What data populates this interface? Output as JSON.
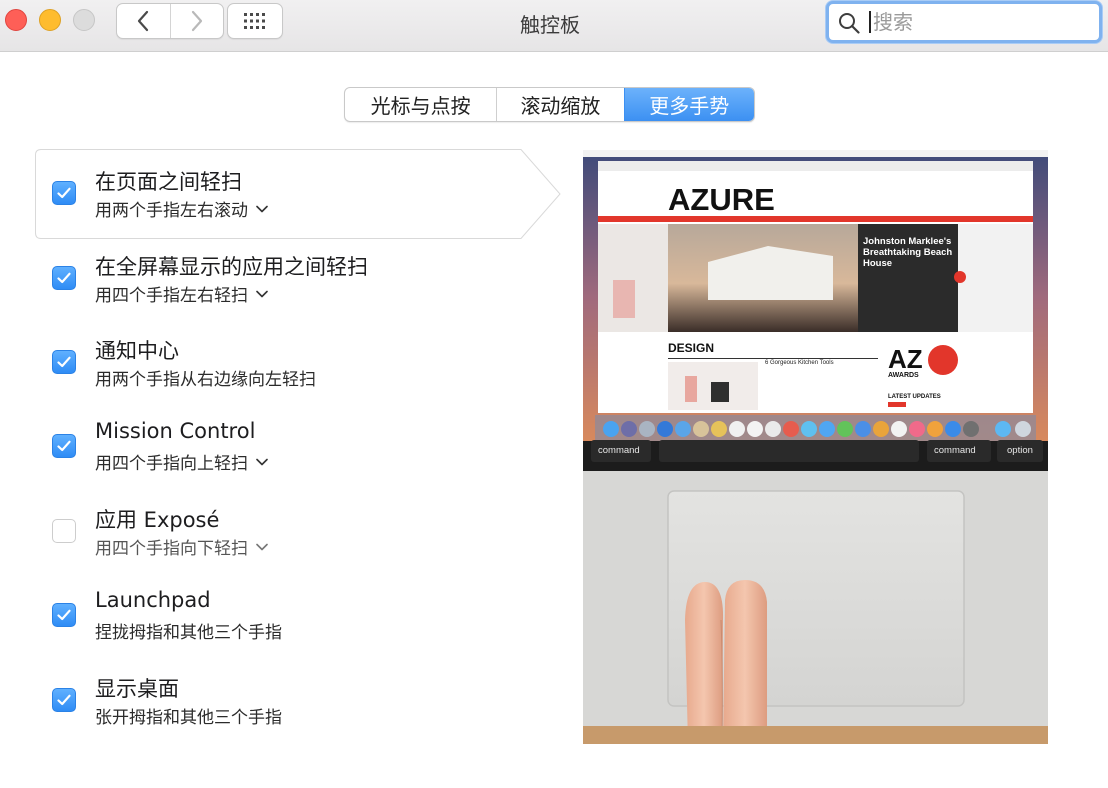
{
  "window": {
    "title": "触控板"
  },
  "toolbar": {
    "back_icon": "chevron-left-icon",
    "forward_icon": "chevron-right-icon",
    "grid_icon": "grid-icon"
  },
  "search": {
    "placeholder": "搜索",
    "value": ""
  },
  "tabs": [
    {
      "label": "光标与点按",
      "active": false
    },
    {
      "label": "滚动缩放",
      "active": false
    },
    {
      "label": "更多手势",
      "active": true
    }
  ],
  "gestures": [
    {
      "title": "在页面之间轻扫",
      "subtitle": "用两个手指左右滚动",
      "checked": true,
      "has_dropdown": true
    },
    {
      "title": "在全屏幕显示的应用之间轻扫",
      "subtitle": "用四个手指左右轻扫",
      "checked": true,
      "has_dropdown": true
    },
    {
      "title": "通知中心",
      "subtitle": "用两个手指从右边缘向左轻扫",
      "checked": true,
      "has_dropdown": false
    },
    {
      "title": "Mission Control",
      "subtitle": "用四个手指向上轻扫",
      "checked": true,
      "has_dropdown": true
    },
    {
      "title": "应用 Exposé",
      "subtitle": "用四个手指向下轻扫",
      "checked": false,
      "has_dropdown": true
    },
    {
      "title": "Launchpad",
      "subtitle": "捏拢拇指和其他三个手指",
      "checked": true,
      "has_dropdown": false
    },
    {
      "title": "显示桌面",
      "subtitle": "张开拇指和其他三个手指",
      "checked": true,
      "has_dropdown": false
    }
  ],
  "preview": {
    "site_logo": "AZURE",
    "headline": "Johnston Marklee's Breathtaking Beach House",
    "section": "DESIGN",
    "article": "6 Gorgeous Kitchen Tools",
    "awards_logo": "AZ",
    "awards_label": "AWARDS",
    "latest": "LATEST UPDATES",
    "key_command_left": "command",
    "key_command_right": "command",
    "key_option": "option"
  },
  "colors": {
    "accent": "#3c90f2",
    "close": "#fe5f57",
    "minimize": "#febc2e",
    "zoom": "#dcdcdc"
  }
}
